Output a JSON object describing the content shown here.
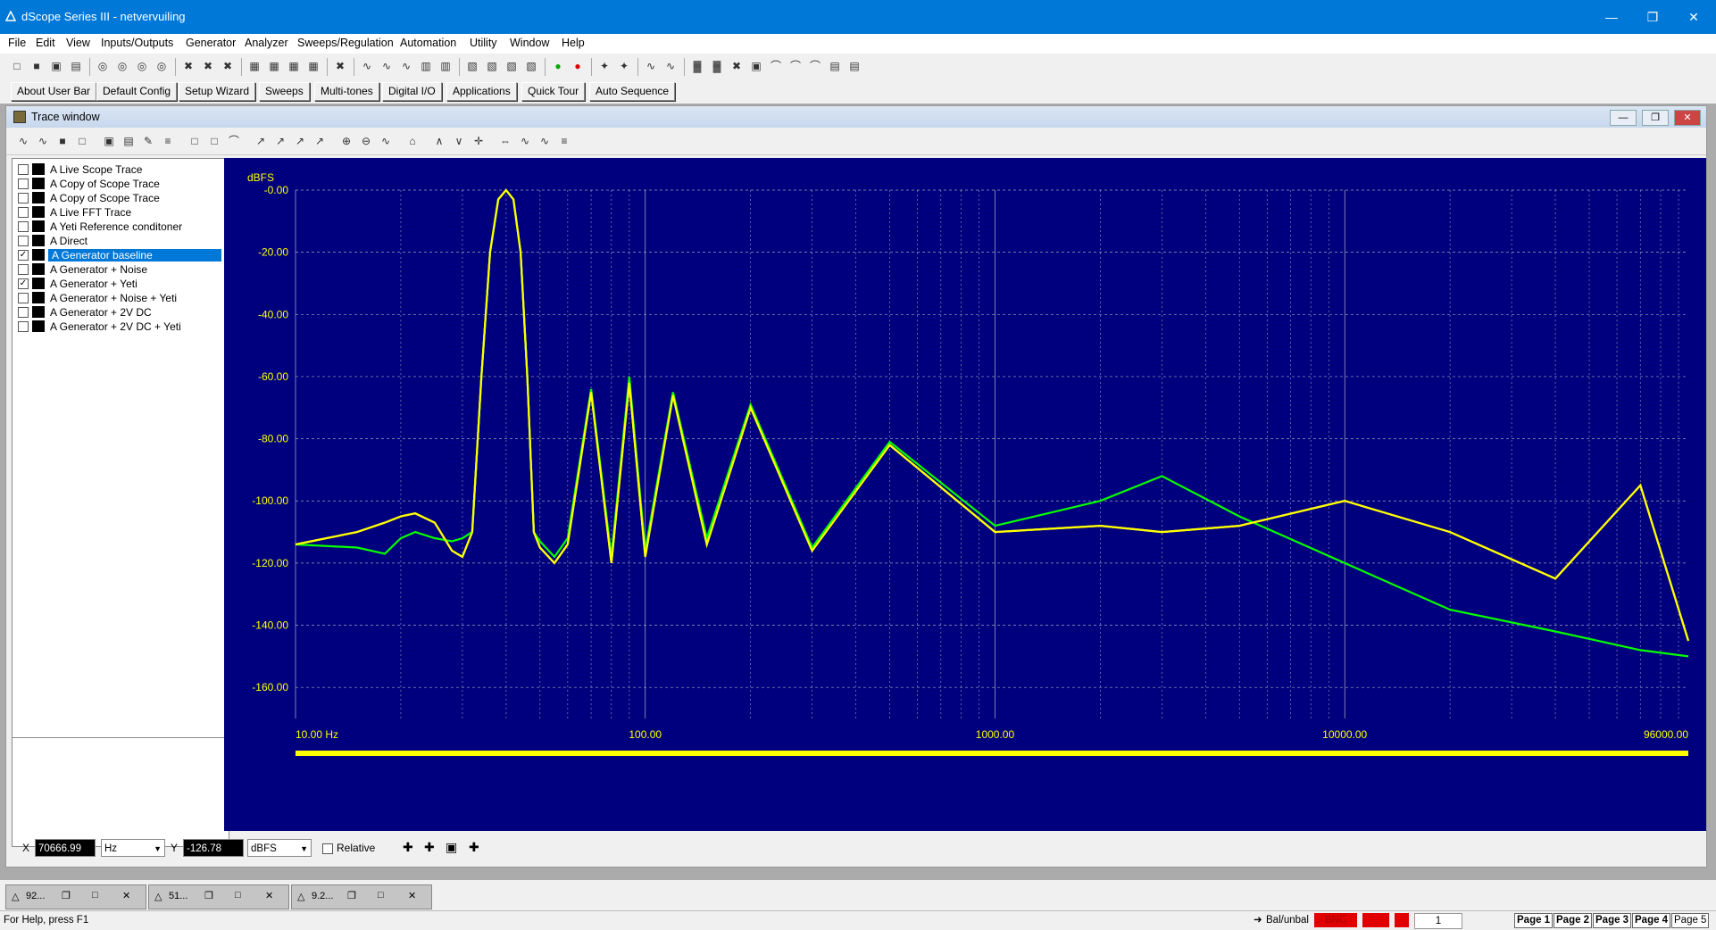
{
  "window": {
    "title": "dScope Series III - netvervuiling"
  },
  "menu": [
    "File",
    "Edit",
    "View",
    "Inputs/Outputs",
    "Generator",
    "Analyzer",
    "Sweeps/Regulation",
    "Automation",
    "Utility",
    "Window",
    "Help"
  ],
  "user_bar": [
    "About User Bar",
    "Default Config",
    "Setup Wizard",
    "Sweeps",
    "Multi-tones",
    "Digital I/O",
    "Applications",
    "Quick Tour",
    "Auto Sequence"
  ],
  "trace_window": {
    "title": "Trace window",
    "traces": [
      {
        "label": "A Live Scope Trace",
        "checked": false,
        "selected": false
      },
      {
        "label": "A Copy of Scope Trace",
        "checked": false,
        "selected": false
      },
      {
        "label": "A Copy of Scope Trace",
        "checked": false,
        "selected": false
      },
      {
        "label": "A Live FFT Trace",
        "checked": false,
        "selected": false
      },
      {
        "label": "A Yeti Reference conditoner",
        "checked": false,
        "selected": false
      },
      {
        "label": "A Direct",
        "checked": false,
        "selected": false
      },
      {
        "label": "A Generator baseline",
        "checked": true,
        "selected": true
      },
      {
        "label": "A Generator + Noise",
        "checked": false,
        "selected": false
      },
      {
        "label": "A Generator + Yeti",
        "checked": true,
        "selected": false
      },
      {
        "label": "A Generator + Noise + Yeti",
        "checked": false,
        "selected": false
      },
      {
        "label": "A Generator + 2V DC",
        "checked": false,
        "selected": false
      },
      {
        "label": "A Generator + 2V DC + Yeti",
        "checked": false,
        "selected": false
      }
    ]
  },
  "chart_data": {
    "type": "line",
    "ylabel": "dBFS",
    "xscale": "log",
    "xlim": [
      10,
      96000
    ],
    "ylim": [
      -170,
      0
    ],
    "yticks": [
      "-0.00",
      "-20.00",
      "-40.00",
      "-60.00",
      "-80.00",
      "-100.00",
      "-120.00",
      "-140.00",
      "-160.00"
    ],
    "xticks": [
      "10.00 Hz",
      "100.00",
      "1000.00",
      "10000.00",
      "96000.00"
    ],
    "grid": true,
    "fundamental_hz": 40,
    "series": [
      {
        "name": "A Generator baseline",
        "color": "#ffff00",
        "x": [
          10,
          15,
          18,
          20,
          22,
          25,
          28,
          30,
          32,
          34,
          36,
          38,
          40,
          42,
          44,
          46,
          48,
          50,
          55,
          60,
          70,
          80,
          90,
          100,
          120,
          150,
          200,
          300,
          500,
          1000,
          2000,
          3000,
          5000,
          10000,
          20000,
          40000,
          70000,
          96000
        ],
        "y": [
          -114,
          -110,
          -107,
          -105,
          -104,
          -107,
          -116,
          -118,
          -110,
          -60,
          -20,
          -3,
          0,
          -3,
          -20,
          -60,
          -110,
          -115,
          -120,
          -114,
          -65,
          -120,
          -62,
          -118,
          -66,
          -114,
          -70,
          -116,
          -82,
          -110,
          -108,
          -110,
          -108,
          -100,
          -110,
          -125,
          -95,
          -145
        ]
      },
      {
        "name": "A Generator + Yeti",
        "color": "#00ff00",
        "x": [
          10,
          15,
          18,
          20,
          22,
          25,
          28,
          30,
          32,
          34,
          36,
          38,
          40,
          42,
          44,
          46,
          48,
          50,
          55,
          60,
          70,
          80,
          90,
          100,
          120,
          150,
          200,
          300,
          500,
          1000,
          2000,
          3000,
          5000,
          10000,
          20000,
          40000,
          70000,
          96000
        ],
        "y": [
          -114,
          -115,
          -117,
          -112,
          -110,
          -112,
          -113,
          -112,
          -110,
          -60,
          -20,
          -3,
          0,
          -3,
          -20,
          -60,
          -110,
          -113,
          -118,
          -112,
          -64,
          -118,
          -60,
          -116,
          -65,
          -112,
          -69,
          -115,
          -81,
          -108,
          -100,
          -92,
          -105,
          -120,
          -135,
          -142,
          -148,
          -150
        ]
      }
    ]
  },
  "cursor": {
    "x_label": "X",
    "x_value": "70666.99",
    "x_unit": "Hz",
    "y_label": "Y",
    "y_value": "-126.78",
    "y_unit": "dBFS",
    "relative_label": "Relative"
  },
  "minimized": [
    "92...",
    "51...",
    "9.2..."
  ],
  "status": {
    "help": "For Help, press F1",
    "bal": "Bal/unbal",
    "bnc": "BNC",
    "count": "1",
    "pages": [
      "Page 1",
      "Page 2",
      "Page 3",
      "Page 4",
      "Page 5"
    ]
  },
  "colors": {
    "plot_bg": "#00007f",
    "grid": "#c8c8c8",
    "axis_text": "#ffff00",
    "title_bar": "#0078d7"
  }
}
